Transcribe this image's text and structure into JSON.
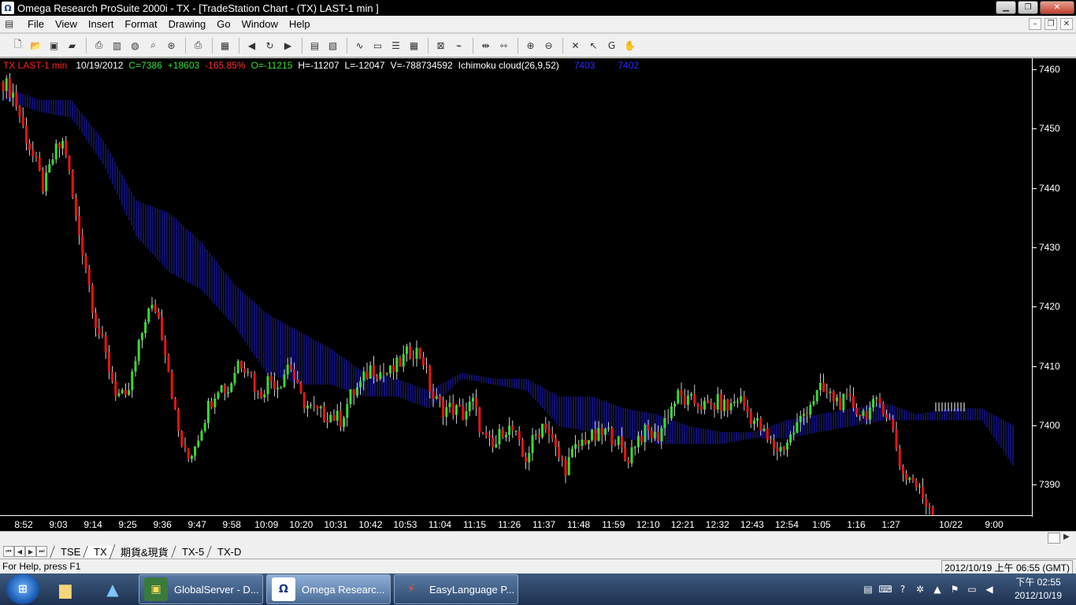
{
  "window": {
    "title": "Omega Research ProSuite 2000i - TX - [TradeStation Chart - (TX)  LAST-1 min ]"
  },
  "menu": {
    "items": [
      "File",
      "Insert",
      "Format",
      "Drawing",
      "Go",
      "Window",
      "Help",
      "View"
    ]
  },
  "menu_ordered": [
    "File",
    "View",
    "Insert",
    "Format",
    "Drawing",
    "Go",
    "Window",
    "Help"
  ],
  "legend": {
    "symbol": "TX LAST-1 min",
    "date": "10/19/2012",
    "close": "C=7386",
    "change": "+18603",
    "pct": "-165.85%",
    "open": "O=-11215",
    "high": "H=-11207",
    "low": "L=-12047",
    "volume": "V=-788734592",
    "indicator": "Ichimoku cloud(26,9,52)",
    "ind_v1": "7403",
    "ind_v2": "7402"
  },
  "colors": {
    "up": "#33dd33",
    "down": "#ee1111",
    "cloud": "#1f1fd0",
    "background": "#000000",
    "axis": "#ffffff",
    "legend_symbol": "#ff2020",
    "legend_green": "#33dd33",
    "legend_red": "#ff3030",
    "legend_blue": "#2a2aff"
  },
  "chart_data": {
    "type": "candlestick",
    "title": "TX LAST-1 min",
    "ylim": [
      7385,
      7462
    ],
    "yticks": [
      "7460",
      "7450",
      "7440",
      "7430",
      "7420",
      "7410",
      "7400",
      "7390"
    ],
    "xticks": [
      "8:52",
      "9:03",
      "9:14",
      "9:25",
      "9:36",
      "9:47",
      "9:58",
      "10:09",
      "10:20",
      "10:31",
      "10:42",
      "10:53",
      "11:04",
      "11:15",
      "11:26",
      "11:37",
      "11:48",
      "11:59",
      "12:10",
      "12:21",
      "12:32",
      "12:43",
      "12:54",
      "1:05",
      "1:16",
      "1:27",
      "10/22",
      "9:00"
    ],
    "price_path": [
      7458,
      7456,
      7450,
      7445,
      7440,
      7446,
      7448,
      7436,
      7428,
      7418,
      7412,
      7406,
      7404,
      7411,
      7419,
      7420,
      7412,
      7400,
      7394,
      7398,
      7403,
      7407,
      7406,
      7411,
      7410,
      7405,
      7408,
      7407,
      7411,
      7405,
      7403,
      7402,
      7402,
      7401,
      7405,
      7407,
      7410,
      7409,
      7409,
      7411,
      7413,
      7412,
      7405,
      7403,
      7403,
      7402,
      7404,
      7398,
      7396,
      7400,
      7399,
      7394,
      7398,
      7401,
      7396,
      7393,
      7396,
      7398,
      7398,
      7399,
      7398,
      7394,
      7398,
      7399,
      7398,
      7402,
      7405,
      7404,
      7404,
      7403,
      7404,
      7403,
      7405,
      7402,
      7400,
      7397,
      7396,
      7398,
      7401,
      7404,
      7406,
      7405,
      7404,
      7404,
      7402,
      7403,
      7404,
      7400,
      7392,
      7391,
      7388,
      7386
    ],
    "cloud_top": [
      7457,
      7455,
      7455,
      7448,
      7438,
      7436,
      7431,
      7424,
      7419,
      7416,
      7413,
      7409,
      7408,
      7406,
      7409,
      7408,
      7408,
      7405,
      7405,
      7403,
      7402,
      7400,
      7399,
      7399,
      7401,
      7402,
      7403,
      7404,
      7402,
      7403,
      7403,
      7400
    ],
    "cloud_bottom": [
      7455,
      7453,
      7452,
      7444,
      7432,
      7426,
      7423,
      7417,
      7409,
      7407,
      7407,
      7405,
      7405,
      7403,
      7408,
      7407,
      7406,
      7400,
      7399,
      7398,
      7397,
      7397,
      7397,
      7398,
      7398,
      7399,
      7400,
      7401,
      7401,
      7401,
      7401,
      7393
    ]
  },
  "tabs": [
    "TSE",
    "TX",
    "期貨&現貨",
    "TX-5",
    "TX-D"
  ],
  "status": {
    "help": "For Help, press F1",
    "datetime": "2012/10/19 上午 06:55 (GMT)"
  },
  "taskbar": {
    "tasks": [
      "GlobalServer - D...",
      "Omega Researc...",
      "EasyLanguage P..."
    ],
    "clock_time": "下午 02:55",
    "clock_date": "2012/10/19"
  }
}
